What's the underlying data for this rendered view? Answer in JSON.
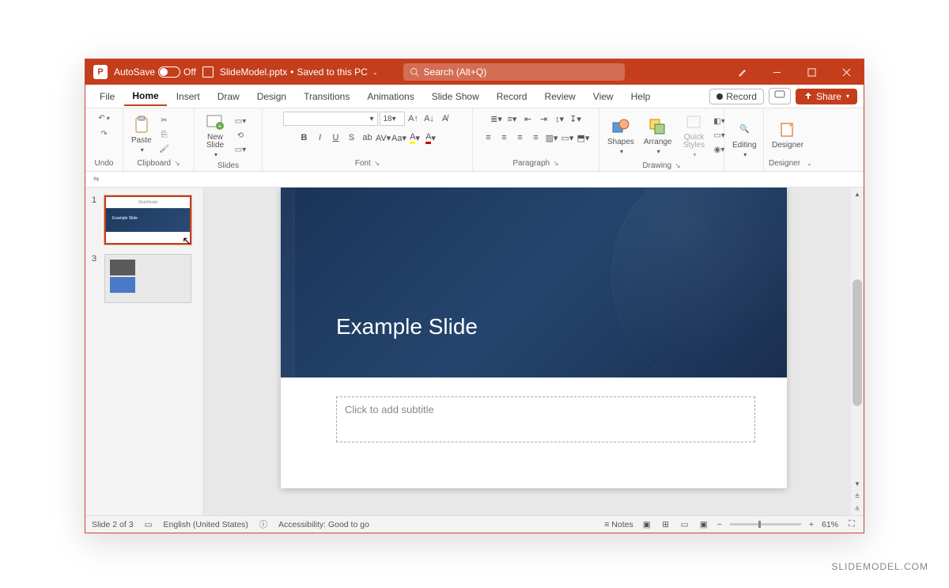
{
  "titlebar": {
    "app_icon": "P",
    "autosave_label": "AutoSave",
    "autosave_state": "Off",
    "file_name": "SlideModel.pptx",
    "saved_status": "Saved to this PC",
    "search_placeholder": "Search (Alt+Q)"
  },
  "menu": {
    "tabs": [
      "File",
      "Home",
      "Insert",
      "Draw",
      "Design",
      "Transitions",
      "Animations",
      "Slide Show",
      "Record",
      "Review",
      "View",
      "Help"
    ],
    "active": "Home",
    "record_btn": "Record",
    "share_btn": "Share"
  },
  "ribbon": {
    "groups": {
      "undo": "Undo",
      "clipboard": "Clipboard",
      "paste": "Paste",
      "slides": "Slides",
      "new_slide": "New Slide",
      "font": "Font",
      "font_size": "18",
      "paragraph": "Paragraph",
      "drawing": "Drawing",
      "shapes": "Shapes",
      "arrange": "Arrange",
      "quick_styles": "Quick Styles",
      "editing": "Editing",
      "designer": "Designer"
    }
  },
  "thumbnails": [
    {
      "num": "1",
      "header": "SlideModel",
      "title": "Example Slide",
      "selected": true
    },
    {
      "num": "3",
      "selected": false
    }
  ],
  "slide": {
    "title": "Example Slide",
    "subtitle_placeholder": "Click to add subtitle"
  },
  "statusbar": {
    "slide_pos": "Slide 2 of 3",
    "language": "English (United States)",
    "accessibility": "Accessibility: Good to go",
    "notes": "Notes",
    "zoom": "61%"
  },
  "watermark": "SLIDEMODEL.COM"
}
